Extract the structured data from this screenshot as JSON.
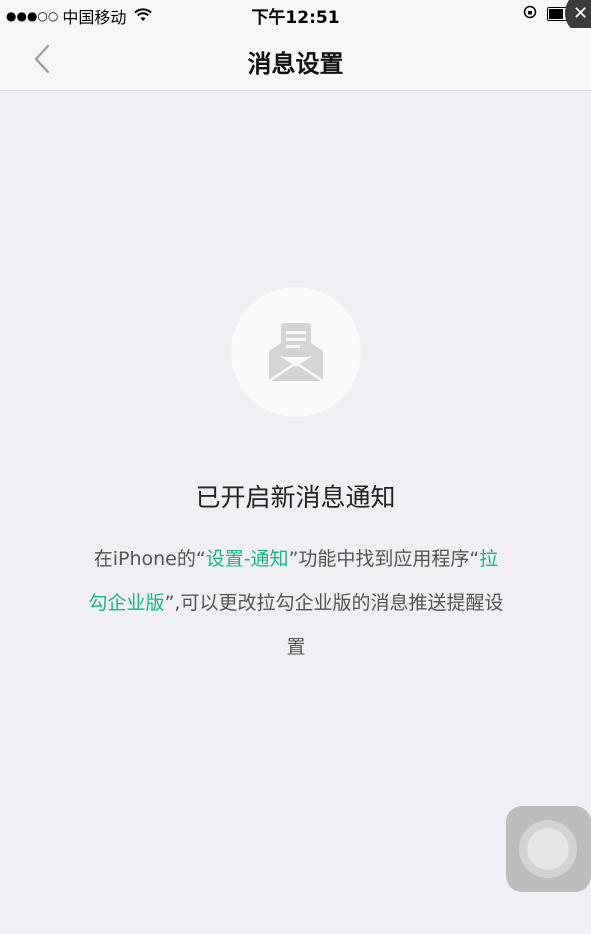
{
  "status_bar": {
    "signal": "●●●○○",
    "carrier": "中国移动",
    "time": "下午12:51"
  },
  "nav": {
    "title": "消息设置"
  },
  "content": {
    "headline": "已开启新消息通知",
    "desc_part1": "在iPhone的“",
    "desc_hl1": "设置-通知",
    "desc_part2": "”功能中找到应用程序“",
    "desc_hl2": "拉勾企业版",
    "desc_part3": "”,可以更改拉勾企业版的消息推送提醒设置"
  },
  "colors": {
    "accent": "#1fb28a",
    "background": "#efeff4"
  },
  "icons": [
    "back-chevron-icon",
    "wifi-icon",
    "rotation-lock-icon",
    "battery-icon",
    "envelope-message-icon",
    "close-icon",
    "assistive-touch-icon"
  ]
}
